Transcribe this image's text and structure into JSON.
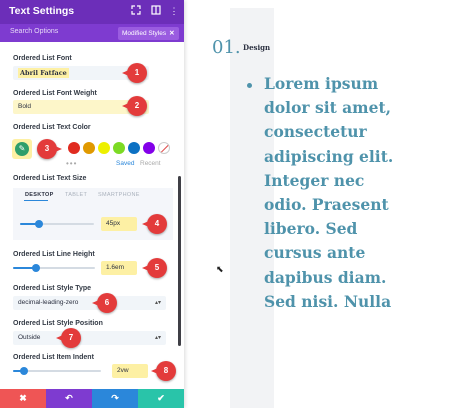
{
  "panel": {
    "title": "Text Settings",
    "search_placeholder": "Search Options",
    "filter_badge": "Modified Styles",
    "filter_badge_close": "✕"
  },
  "fields": {
    "font_label": "Ordered List Font",
    "font_value": "Abril Fatface",
    "weight_label": "Ordered List Font Weight",
    "weight_value": "Bold",
    "color_label": "Ordered List Text Color",
    "color_tab_saved": "Saved",
    "color_tab_recent": "Recent",
    "size_label": "Ordered List Text Size",
    "device_tabs": [
      "DESKTOP",
      "TABLET",
      "SMARTPHONE"
    ],
    "size_value": "45px",
    "size_level": 0.25,
    "line_height_label": "Ordered List Line Height",
    "line_height_value": "1.6em",
    "line_height_level": 0.28,
    "style_type_label": "Ordered List Style Type",
    "style_type_value": "decimal-leading-zero",
    "style_position_label": "Ordered List Style Position",
    "style_position_value": "Outside",
    "indent_label": "Ordered List Item Indent",
    "indent_value": "2vw",
    "indent_level": 0.12
  },
  "swatches": [
    "#2b2b2b",
    "#ffffff",
    "#e02b20",
    "#e09900",
    "#edf000",
    "#7cda24",
    "#0c71c3",
    "#8300e9"
  ],
  "callouts": [
    "1",
    "2",
    "3",
    "4",
    "5",
    "6",
    "7",
    "8"
  ],
  "footer": {
    "cancel_icon": "✖",
    "undo_icon": "↶",
    "redo_icon": "↷",
    "save_icon": "✔",
    "colors": [
      "#ef5555",
      "#7e3bd0",
      "#2b87da",
      "#29c4a9"
    ]
  },
  "preview": {
    "marker": "01.",
    "marker_label": "Design",
    "lorem_lines": [
      "Lorem ipsum",
      "dolor sit amet,",
      "consectetur",
      "adipiscing elit.",
      "Integer nec",
      "odio. Praesent",
      "libero. Sed",
      "cursus ante",
      "dapibus diam.",
      "Sed nisi. Nulla"
    ],
    "text_color": "#4f93ab"
  }
}
